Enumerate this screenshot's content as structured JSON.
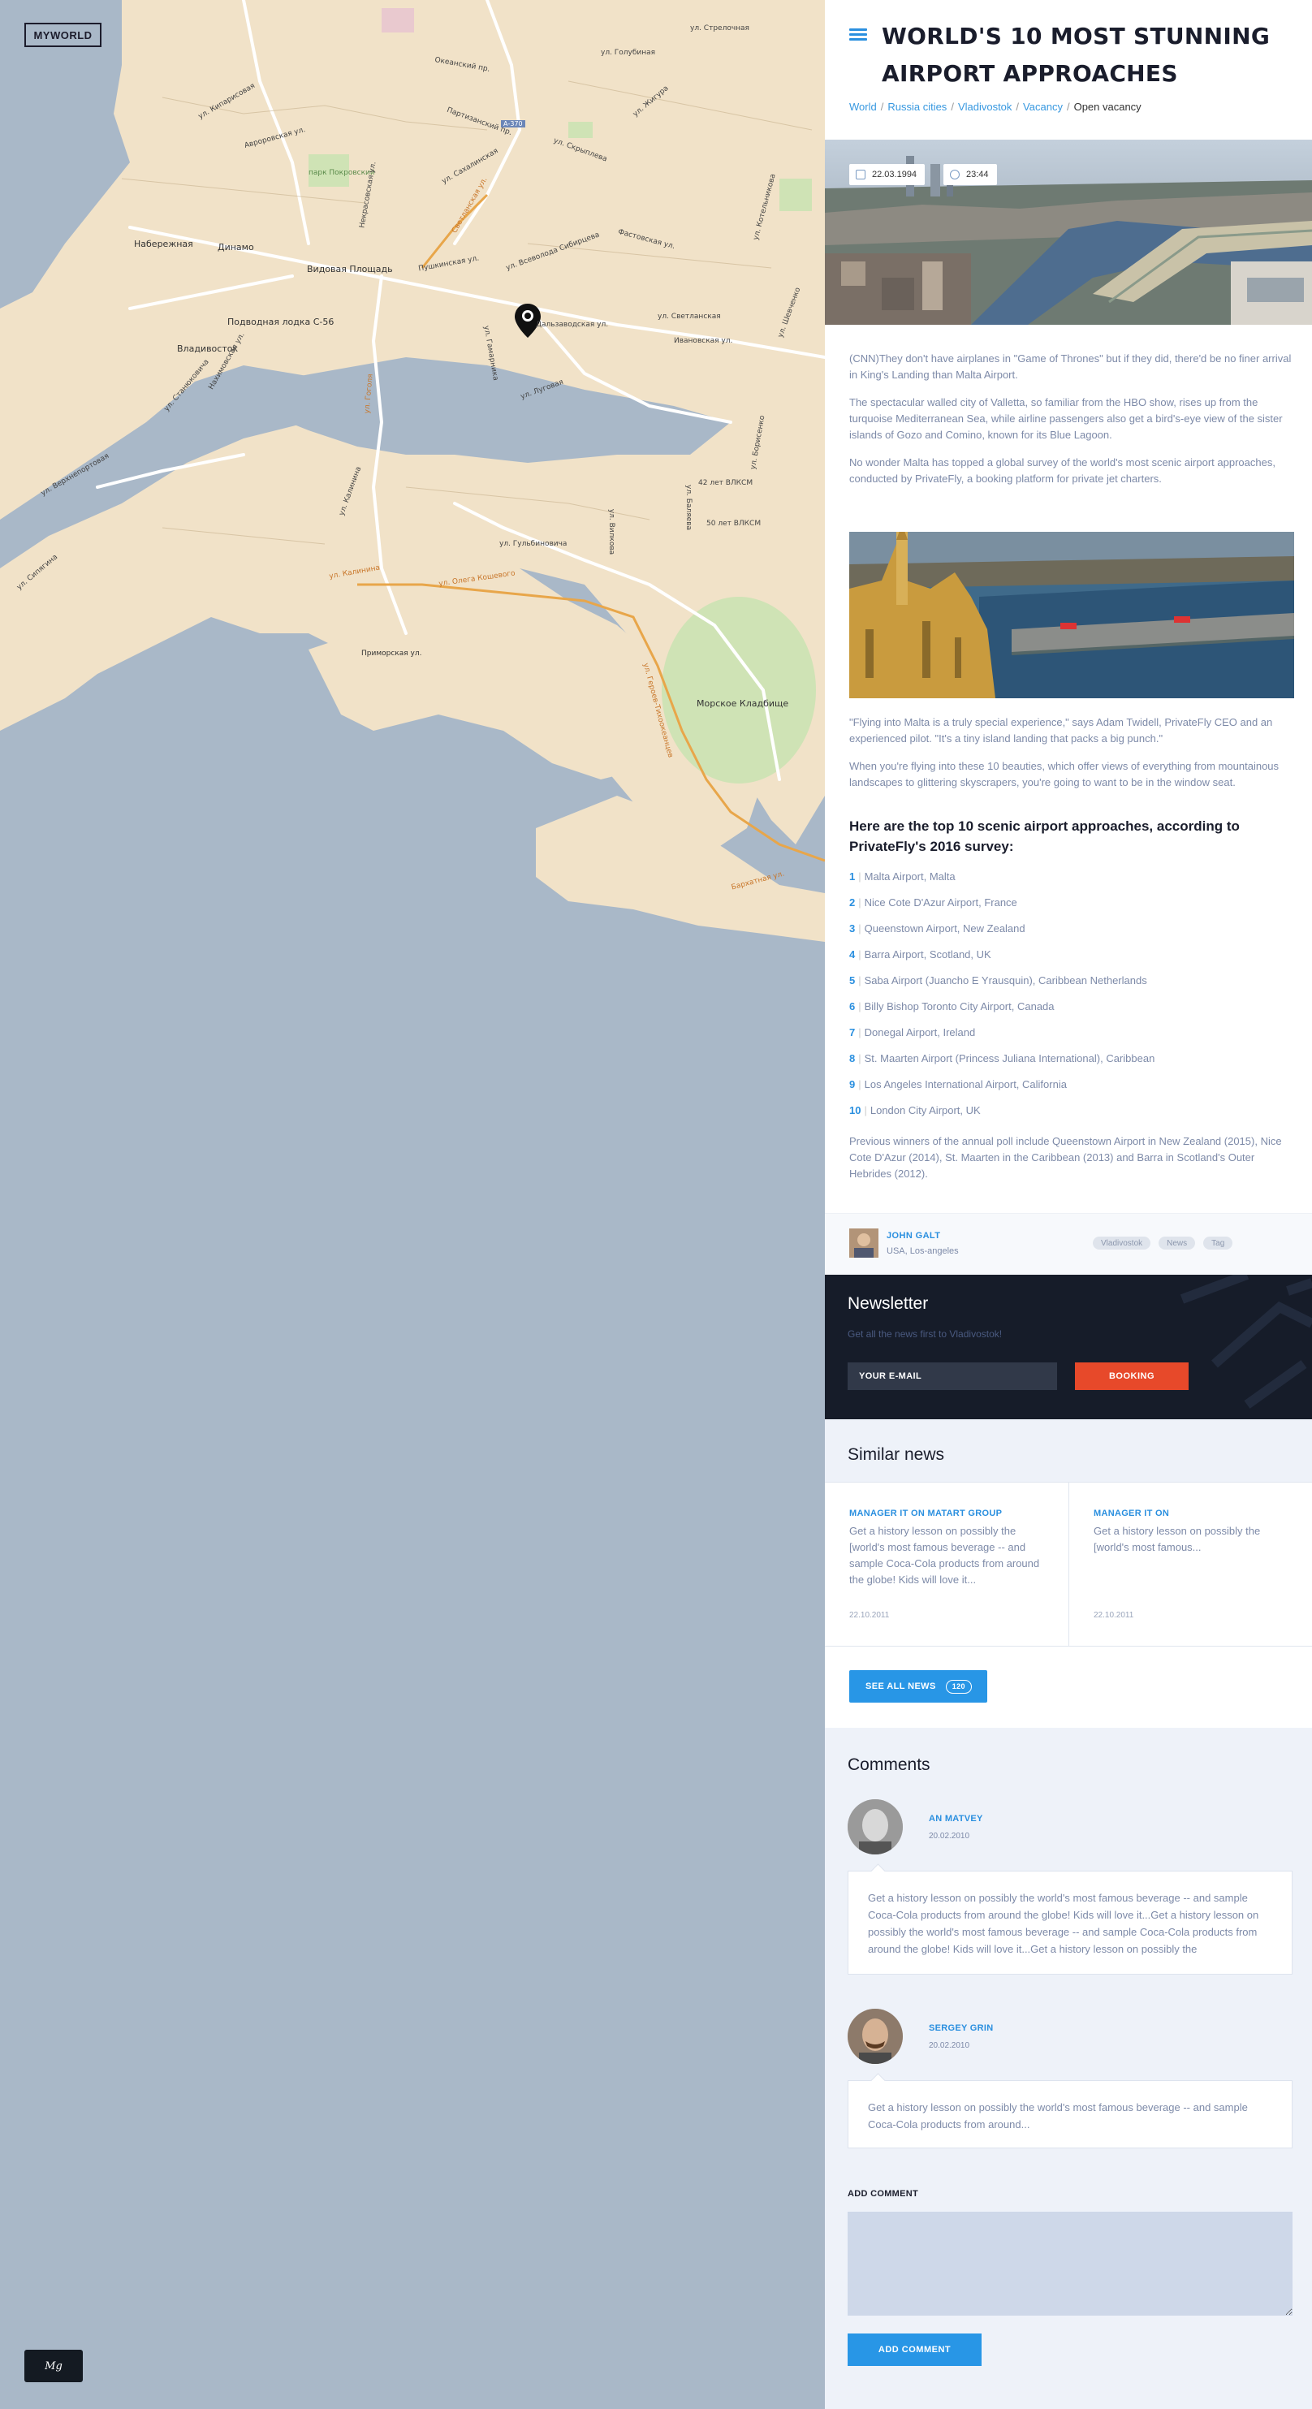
{
  "logo": "MYWORLD",
  "brand": "Mg",
  "map": {
    "labels": [
      "Набережная",
      "Динамо",
      "Видовая Площадь",
      "Подводная лодка С-56",
      "Владивосток",
      "парк Покровский",
      "Морское Кладбище",
      "Приморская ул.",
      "А-370"
    ],
    "streets_orange": [
      "ул. Калинина",
      "ул. Олега Кошевого",
      "ул. Героев-Тихоокеанцев",
      "Светланская ул.",
      "ул. Гоголя"
    ],
    "streets": [
      "ул. Светланская",
      "Пушкинская ул.",
      "Партизанский пр.",
      "Авроровская ул.",
      "Океанский пр.",
      "Некрасовская ул.",
      "ул. Всеволода Сибирцева",
      "Ивановская ул.",
      "Дальзаводская ул.",
      "ул. Калинина",
      "ул. Сахалинская",
      "ул. Вилкова",
      "ул. Скрыплева",
      "ул. Стрелочная",
      "Фастовская ул.",
      "ул. Верхнепортовая",
      "ул. Станюковича",
      "Нахимовская ул.",
      "ул. Сипягина",
      "ул. Гамарника",
      "ул. Гульбиновича",
      "ул. Жигура",
      "ул. Кипарисовая",
      "ул. Голубиная",
      "ул. Баляева",
      "ул. Борисенко",
      "ул. Котельникова",
      "42 лет ВЛКСМ",
      "50 лет ВЛКСМ",
      "Бархатная ул.",
      "ул. Шевченко",
      "ул. Луговая"
    ]
  },
  "header": {
    "title": "WORLD'S 10 MOST STUNNING AIRPORT APPROACHES",
    "breadcrumbs": [
      "World",
      "Russia cities",
      "Vladivostok",
      "Vacancy"
    ],
    "current": "Open vacancy"
  },
  "hero": {
    "date": "22.03.1994",
    "time": "23:44",
    "date_icon": "calendar-icon",
    "time_icon": "clock-icon"
  },
  "article": {
    "p1": "(CNN)They don't have airplanes in \"Game of Thrones\" but if they did, there'd be no finer arrival in King's Landing than Malta Airport.",
    "p2": "The spectacular walled city of Valletta, so familiar from the HBO show, rises up from the turquoise Mediterranean Sea, while airline passengers also get a bird's-eye view of the sister islands of Gozo and Comino, known for its Blue Lagoon.",
    "p3": "No wonder Malta has topped a global survey of the world's most scenic airport approaches, conducted by PrivateFly, a booking platform for private jet charters.",
    "p4": "\"Flying into Malta is a truly special experience,\" says Adam Twidell, PrivateFly CEO and an experienced pilot. \"It's a tiny island landing that packs a big punch.\"",
    "p5": "When you're flying into these 10 beauties, which offer views of everything from mountainous landscapes to glittering skyscrapers, you're going to want to be in the window seat.",
    "list_title": "Here are the top 10 scenic airport approaches, according to PrivateFly's 2016 survey:",
    "list": [
      {
        "n": "1",
        "t": "Malta Airport, Malta"
      },
      {
        "n": "2",
        "t": "Nice Cote D'Azur Airport, France"
      },
      {
        "n": "3",
        "t": "Queenstown Airport, New Zealand"
      },
      {
        "n": "4",
        "t": "Barra Airport, Scotland, UK"
      },
      {
        "n": "5",
        "t": "Saba Airport (Juancho E Yrausquin), Caribbean Netherlands"
      },
      {
        "n": "6",
        "t": "Billy Bishop Toronto City Airport, Canada"
      },
      {
        "n": "7",
        "t": "Donegal Airport, Ireland"
      },
      {
        "n": "8",
        "t": "St. Maarten Airport (Princess Juliana International), Caribbean"
      },
      {
        "n": "9",
        "t": "Los Angeles International Airport, California"
      },
      {
        "n": "10",
        "t": "London City Airport, UK"
      }
    ],
    "prev": "Previous winners of the annual poll include Queenstown Airport in New Zealand (2015), Nice Cote D'Azur (2014), St. Maarten in the Caribbean (2013) and Barra in Scotland's Outer Hebrides (2012)."
  },
  "author": {
    "name": "JOHN GALT",
    "location": "USA, Los-angeles",
    "tags": [
      "Vladivostok",
      "News",
      "Tag"
    ]
  },
  "newsletter": {
    "title": "Newsletter",
    "subtitle": "Get all the news first to Vladivostok!",
    "placeholder": "YOUR E-MAIL",
    "button": "BOOKING"
  },
  "similar": {
    "title": "Similar news",
    "cards": [
      {
        "title": "MANAGER IT ON MATART GROUP",
        "body": "Get a history lesson on possibly the [world's most famous beverage -- and sample Coca-Cola products from around the globe! Kids will love it...",
        "date": "22.10.2011"
      },
      {
        "title": "MANAGER IT ON",
        "body": "Get a history lesson on possibly the [world's most famous...",
        "date": "22.10.2011"
      }
    ],
    "see_all": "SEE ALL NEWS",
    "count": "120"
  },
  "comments": {
    "title": "Comments",
    "items": [
      {
        "name": "AN MATVEY",
        "date": "20.02.2010",
        "text": "Get a history lesson on possibly the world's most famous beverage -- and sample Coca-Cola products from around the globe! Kids will love it...Get a history lesson on possibly the world's most famous beverage -- and sample Coca-Cola products from around the globe! Kids will love it...Get a history lesson on possibly the"
      },
      {
        "name": "SERGEY GRIN",
        "date": "20.02.2010",
        "text": "Get a history lesson on possibly the world's most famous beverage -- and sample Coca-Cola products from around..."
      }
    ],
    "add_label": "ADD COMMENT",
    "add_button": "ADD COMMENT"
  }
}
